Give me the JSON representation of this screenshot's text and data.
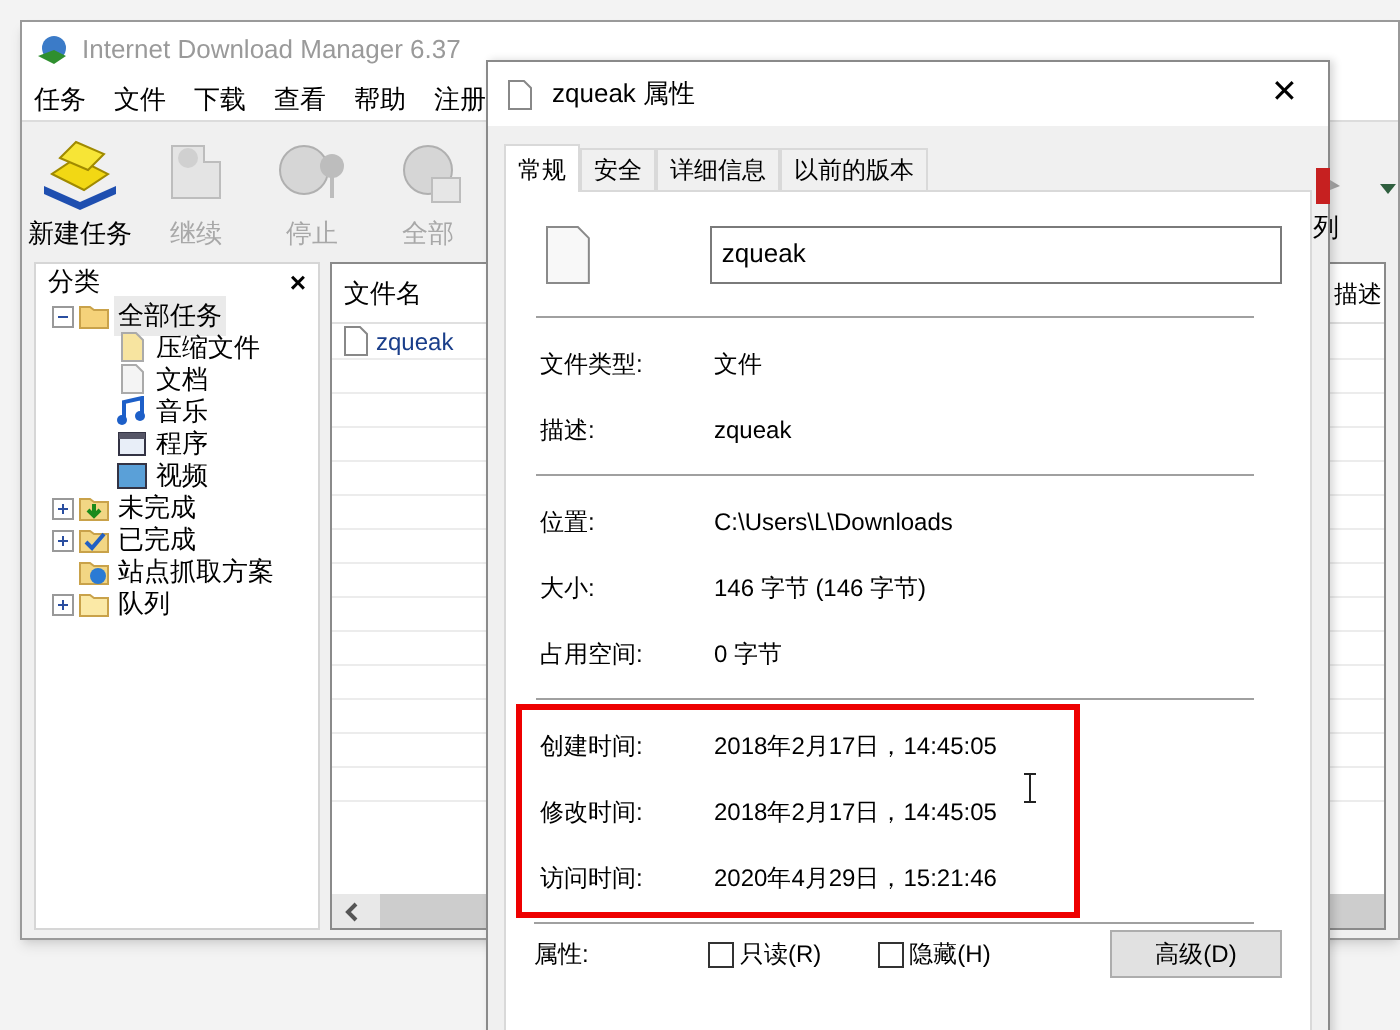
{
  "idm_window": {
    "title": "Internet Download Manager 6.37",
    "menu": [
      "任务",
      "文件",
      "下载",
      "查看",
      "帮助",
      "注册"
    ],
    "toolbar": [
      {
        "label": "新建任务",
        "disabled": false
      },
      {
        "label": "继续",
        "disabled": true
      },
      {
        "label": "停止",
        "disabled": true
      },
      {
        "label": "全部",
        "disabled": true
      }
    ],
    "toolbar_right": {
      "label": "列"
    },
    "category_panel": {
      "title": "分类",
      "close": "×",
      "tree": [
        {
          "label": "全部任务",
          "kind": "folder-open",
          "expanded": true,
          "selected": true,
          "children": [
            {
              "label": "压缩文件",
              "kind": "zip"
            },
            {
              "label": "文档",
              "kind": "document"
            },
            {
              "label": "音乐",
              "kind": "music"
            },
            {
              "label": "程序",
              "kind": "program"
            },
            {
              "label": "视频",
              "kind": "video"
            }
          ]
        },
        {
          "label": "未完成",
          "kind": "folder-download",
          "expanded": false,
          "selected": false
        },
        {
          "label": "已完成",
          "kind": "folder-check",
          "expanded": false,
          "selected": false
        },
        {
          "label": "站点抓取方案",
          "kind": "folder-web",
          "selected": false
        },
        {
          "label": "队列",
          "kind": "folders",
          "expanded": false,
          "selected": false
        }
      ]
    },
    "file_list": {
      "columns": [
        "文件名",
        "描述"
      ],
      "rows": [
        {
          "file_name": "zqueak"
        }
      ]
    }
  },
  "properties_dialog": {
    "title": "zqueak 属性",
    "close": "✕",
    "tabs": [
      {
        "label": "常规",
        "selected": true
      },
      {
        "label": "安全",
        "selected": false
      },
      {
        "label": "详细信息",
        "selected": false
      },
      {
        "label": "以前的版本",
        "selected": false
      }
    ],
    "name_field": {
      "value": "zqueak"
    },
    "groups": [
      {
        "highlighted": false,
        "rows": [
          {
            "label": "文件类型:",
            "value": "文件"
          },
          {
            "label": "描述:",
            "value": "zqueak"
          }
        ]
      },
      {
        "highlighted": false,
        "rows": [
          {
            "label": "位置:",
            "value": "C:\\Users\\L\\Downloads"
          },
          {
            "label": "大小:",
            "value": "146 字节 (146 字节)"
          },
          {
            "label": "占用空间:",
            "value": "0 字节"
          }
        ]
      },
      {
        "highlighted": true,
        "rows": [
          {
            "label": "创建时间:",
            "value": "2018年2月17日，14:45:05"
          },
          {
            "label": "修改时间:",
            "value": "2018年2月17日，14:45:05"
          },
          {
            "label": "访问时间:",
            "value": "2020年4月29日，15:21:46"
          }
        ]
      }
    ],
    "attributes": {
      "label": "属性:",
      "checkboxes": [
        {
          "label": "只读(R)",
          "checked": false
        },
        {
          "label": "隐藏(H)",
          "checked": false
        }
      ],
      "button": "高级(D)"
    }
  }
}
